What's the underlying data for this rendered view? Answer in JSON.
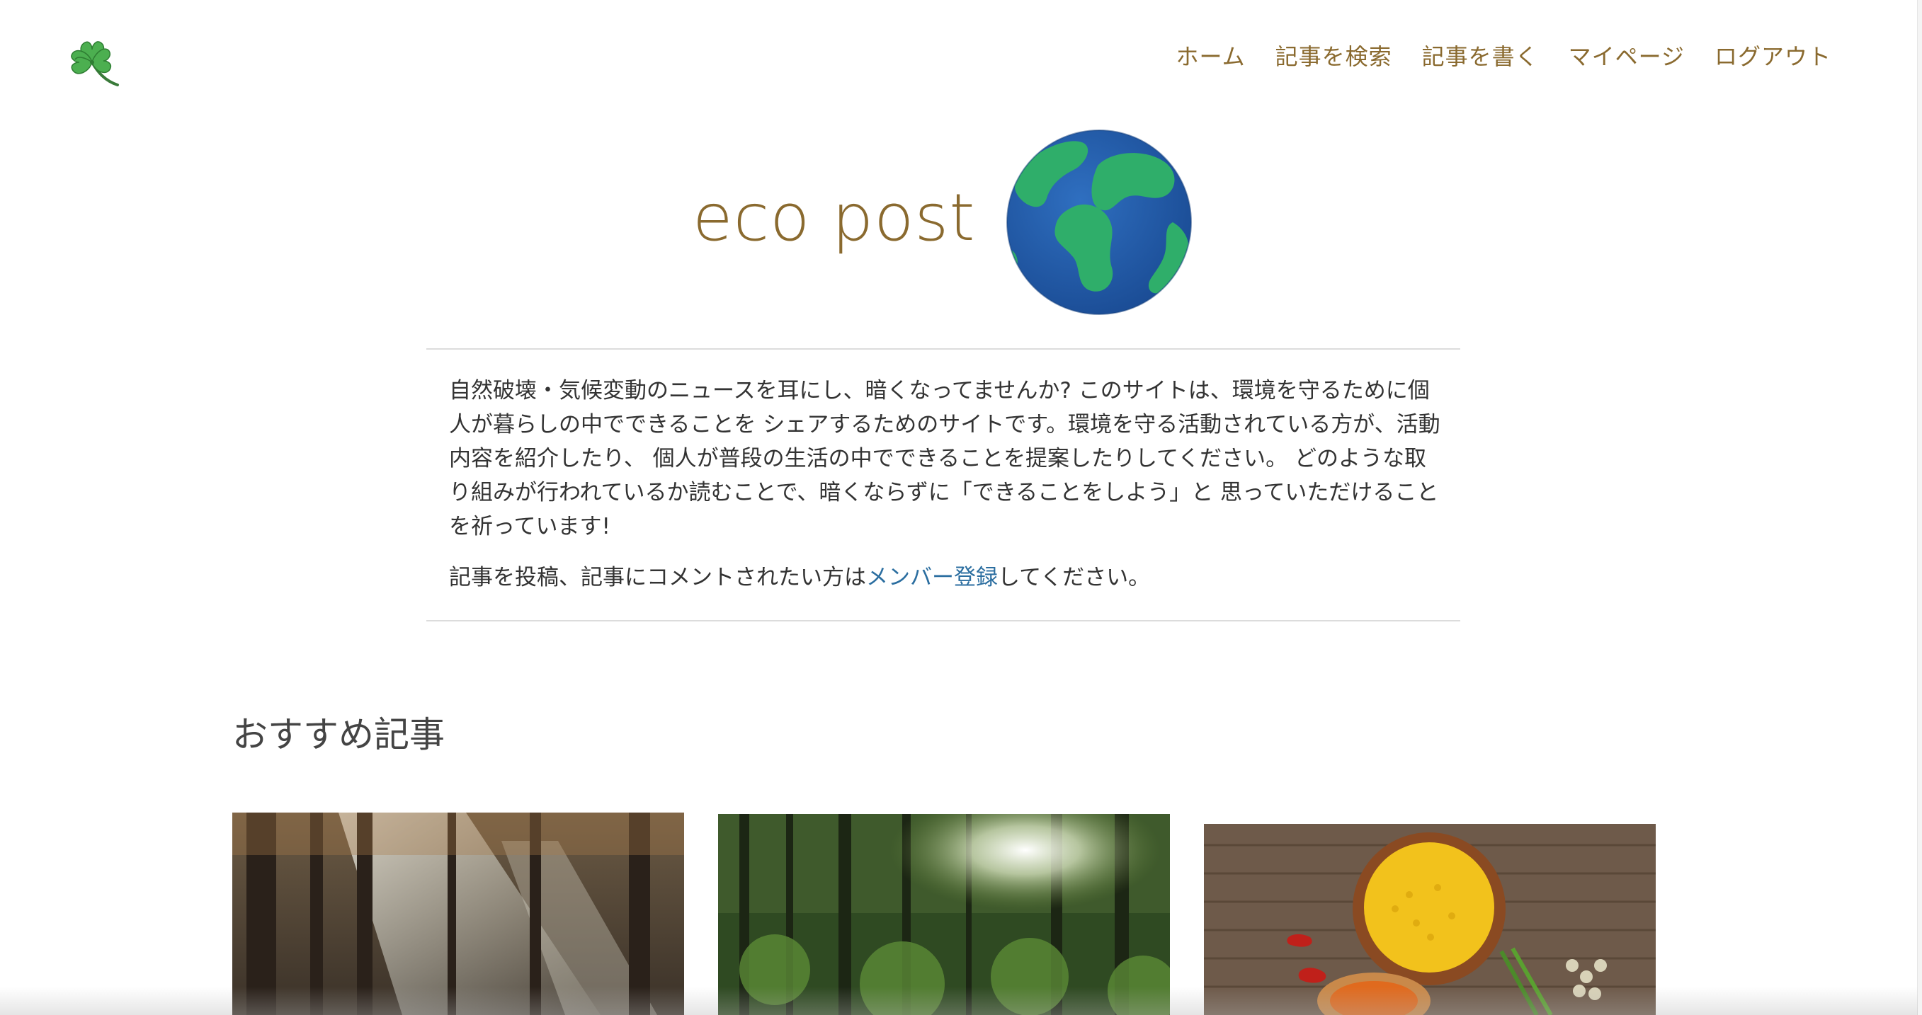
{
  "header": {
    "logo_icon": "four-leaf-clover-icon",
    "nav": [
      {
        "label": "ホーム"
      },
      {
        "label": "記事を検索"
      },
      {
        "label": "記事を書く"
      },
      {
        "label": "マイページ"
      },
      {
        "label": "ログアウト"
      }
    ]
  },
  "hero": {
    "brand": "eco post",
    "globe_icon": "earth-globe-icon"
  },
  "intro": {
    "paragraph": "自然破壊・気候変動のニュースを耳にし、暗くなってませんか? このサイトは、環境を守るために個人が暮らしの中でできることを シェアするためのサイトです。環境を守る活動されている方が、活動内容を紹介したり、 個人が普段の生活の中でできることを提案したりしてください。 どのような取り組みが行われているか読むことで、暗くならずに「できることをしよう」と 思っていただけることを祈っています!",
    "cta_before": "記事を投稿、記事にコメントされたい方は",
    "cta_link": "メンバー登録",
    "cta_after": "してください。"
  },
  "featured": {
    "title": "おすすめ記事",
    "cards": [
      {
        "image": "misty-forest-photo"
      },
      {
        "image": "green-forest-sunlight-photo"
      },
      {
        "image": "lentils-and-chili-photo"
      }
    ]
  },
  "colors": {
    "brand": "#8a6a2f",
    "link": "#2b6ea0",
    "text": "#333333"
  }
}
